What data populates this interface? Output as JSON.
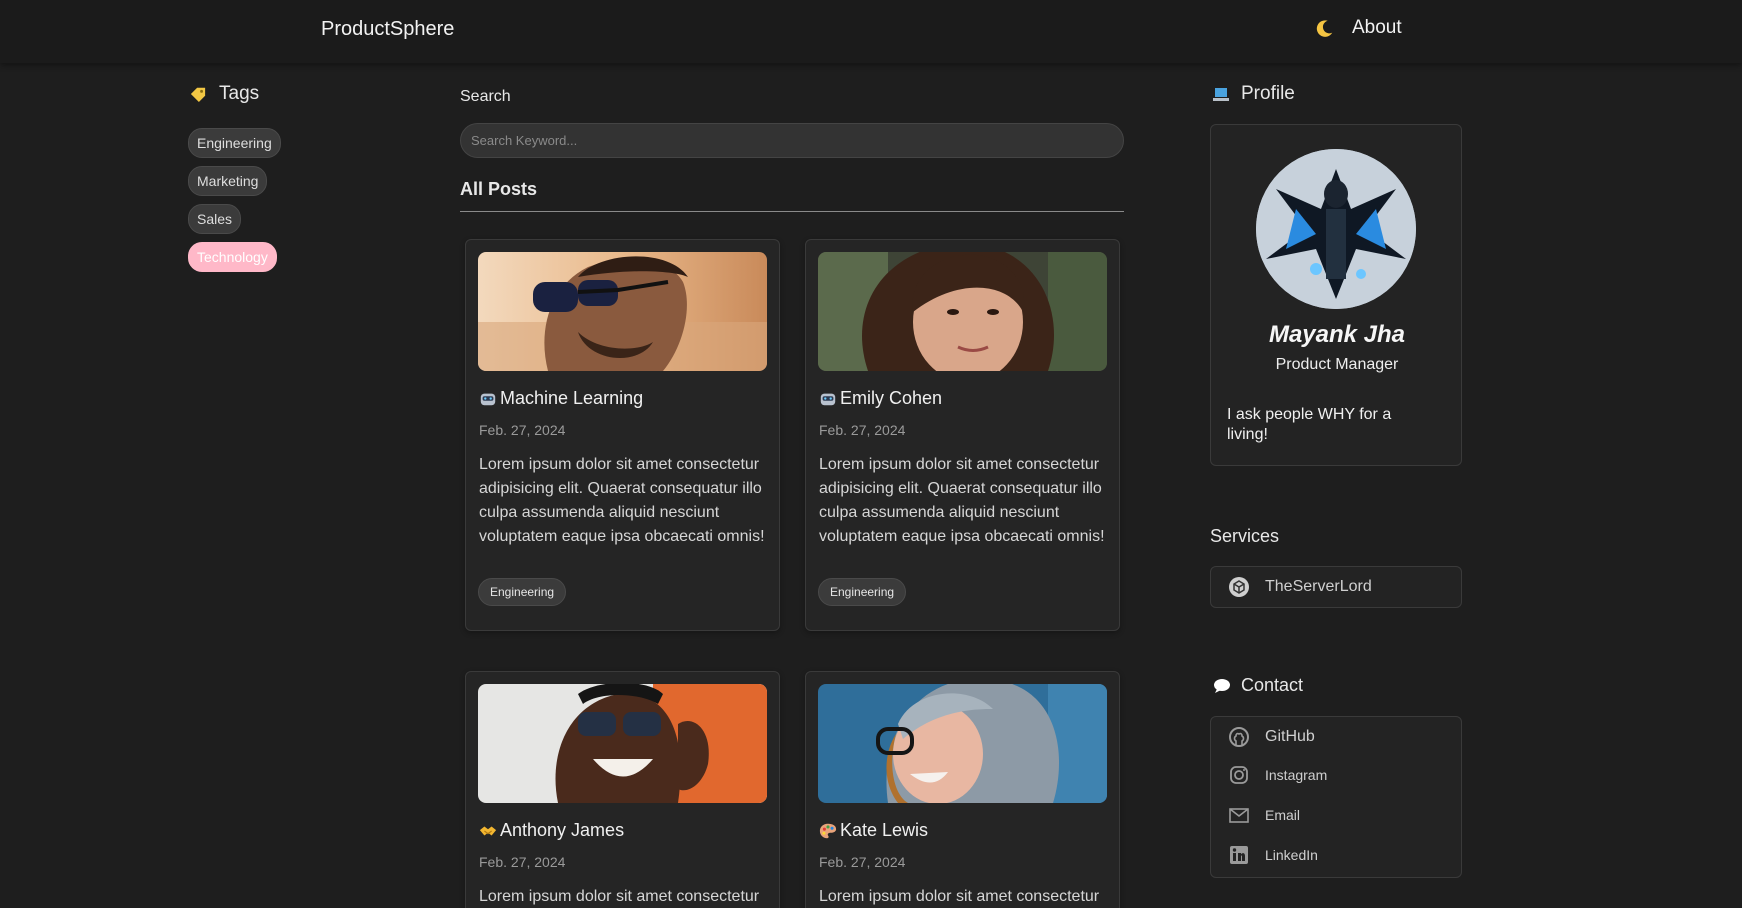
{
  "header": {
    "brand": "ProductSphere",
    "theme_icon": "crescent-moon-icon",
    "about_label": "About"
  },
  "tags": {
    "title": "Tags",
    "items": [
      {
        "label": "Engineering",
        "active": false
      },
      {
        "label": "Marketing",
        "active": false
      },
      {
        "label": "Sales",
        "active": false
      },
      {
        "label": "Technology",
        "active": true
      }
    ]
  },
  "search": {
    "label": "Search",
    "placeholder": "Search Keyword..."
  },
  "posts": {
    "heading": "All Posts",
    "items": [
      {
        "title": "Machine Learning",
        "emoji": "robot-face-icon",
        "date": "Feb. 27, 2024",
        "body": "Lorem ipsum dolor sit amet consectetur adipisicing elit. Quaerat consequatur illo culpa assumenda aliquid nesciunt voluptatem eaque ipsa obcaecati omnis!",
        "tag": "Engineering"
      },
      {
        "title": "Emily Cohen",
        "emoji": "robot-face-icon",
        "date": "Feb. 27, 2024",
        "body": "Lorem ipsum dolor sit amet consectetur adipisicing elit. Quaerat consequatur illo culpa assumenda aliquid nesciunt voluptatem eaque ipsa obcaecati omnis!",
        "tag": "Engineering"
      },
      {
        "title": "Anthony James",
        "emoji": "handshake-icon",
        "date": "Feb. 27, 2024",
        "body": "Lorem ipsum dolor sit amet consectetur",
        "tag": ""
      },
      {
        "title": "Kate Lewis",
        "emoji": "artist-palette-icon",
        "date": "Feb. 27, 2024",
        "body": "Lorem ipsum dolor sit amet consectetur",
        "tag": ""
      }
    ]
  },
  "profile": {
    "title": "Profile",
    "name": "Mayank Jha",
    "role": "Product Manager",
    "bio": "I ask people WHY for a living!"
  },
  "services": {
    "title": "Services",
    "items": [
      {
        "label": "TheServerLord",
        "icon": "cube-icon"
      }
    ]
  },
  "contact": {
    "title": "Contact",
    "items": [
      {
        "label": "GitHub",
        "icon": "github-icon"
      },
      {
        "label": "Instagram",
        "icon": "instagram-icon"
      },
      {
        "label": "Email",
        "icon": "email-icon"
      },
      {
        "label": "LinkedIn",
        "icon": "linkedin-icon"
      }
    ]
  },
  "colors": {
    "background": "#1e1e1e",
    "card": "#252525",
    "active_tag": "#ffb8c8"
  }
}
